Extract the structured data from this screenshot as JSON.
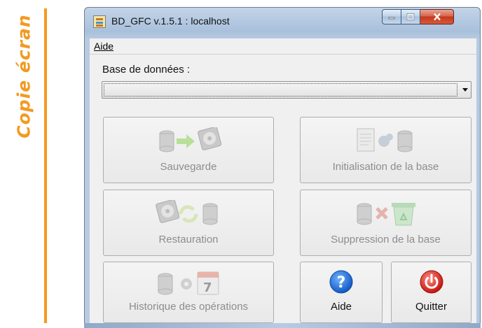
{
  "side_caption": "Copie écran",
  "window": {
    "title": "BD_GFC v.1.5.1 : localhost",
    "controls": {
      "minimize": "minimize-icon",
      "maximize": "maximize-icon",
      "close": "close-icon"
    }
  },
  "menu": {
    "items": [
      {
        "label": "Aide"
      }
    ]
  },
  "database": {
    "label": "Base de données :",
    "selected_value": ""
  },
  "tiles": {
    "sauvegarde": {
      "label": "Sauvegarde",
      "icon": "backup-icon",
      "enabled": false
    },
    "initialisation": {
      "label": "Initialisation de la base",
      "icon": "initialize-database-icon",
      "enabled": false
    },
    "restauration": {
      "label": "Restauration",
      "icon": "restore-icon",
      "enabled": false
    },
    "suppression": {
      "label": "Suppression de la base",
      "icon": "delete-database-icon",
      "enabled": false
    },
    "historique": {
      "label": "Historique des opérations",
      "icon": "history-icon",
      "enabled": false
    },
    "aide": {
      "label": "Aide",
      "icon": "help-icon",
      "enabled": true
    },
    "quitter": {
      "label": "Quitter",
      "icon": "power-icon",
      "enabled": true
    }
  },
  "colors": {
    "accent_orange": "#f39a21",
    "help_blue": "#1f6fd6",
    "quit_red": "#d7261a",
    "disabled_text": "#8d8d8d"
  }
}
